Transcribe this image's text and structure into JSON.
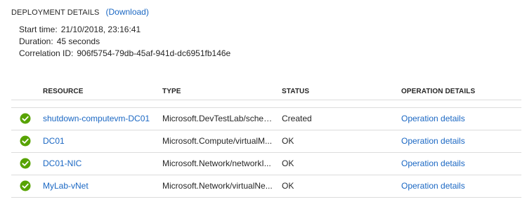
{
  "header": {
    "title": "DEPLOYMENT DETAILS",
    "download_label": "(Download)"
  },
  "details": {
    "start_time_label": "Start time:",
    "start_time_value": "21/10/2018, 23:16:41",
    "duration_label": "Duration:",
    "duration_value": "45 seconds",
    "correlation_label": "Correlation ID:",
    "correlation_value": "906f5754-79db-45af-941d-dc6951fb146e"
  },
  "table": {
    "columns": [
      "RESOURCE",
      "TYPE",
      "STATUS",
      "OPERATION DETAILS"
    ],
    "rows": [
      {
        "resource": "shutdown-computevm-DC01",
        "type": "Microsoft.DevTestLab/sched...",
        "status": "Created",
        "details": "Operation details"
      },
      {
        "resource": "DC01",
        "type": "Microsoft.Compute/virtualM...",
        "status": "OK",
        "details": "Operation details"
      },
      {
        "resource": "DC01-NIC",
        "type": "Microsoft.Network/networkI...",
        "status": "OK",
        "details": "Operation details"
      },
      {
        "resource": "MyLab-vNet",
        "type": "Microsoft.Network/virtualNe...",
        "status": "OK",
        "details": "Operation details"
      }
    ]
  },
  "colors": {
    "link": "#1a67c3",
    "success": "#57a300"
  },
  "icons": {
    "status": "success-check-icon"
  }
}
